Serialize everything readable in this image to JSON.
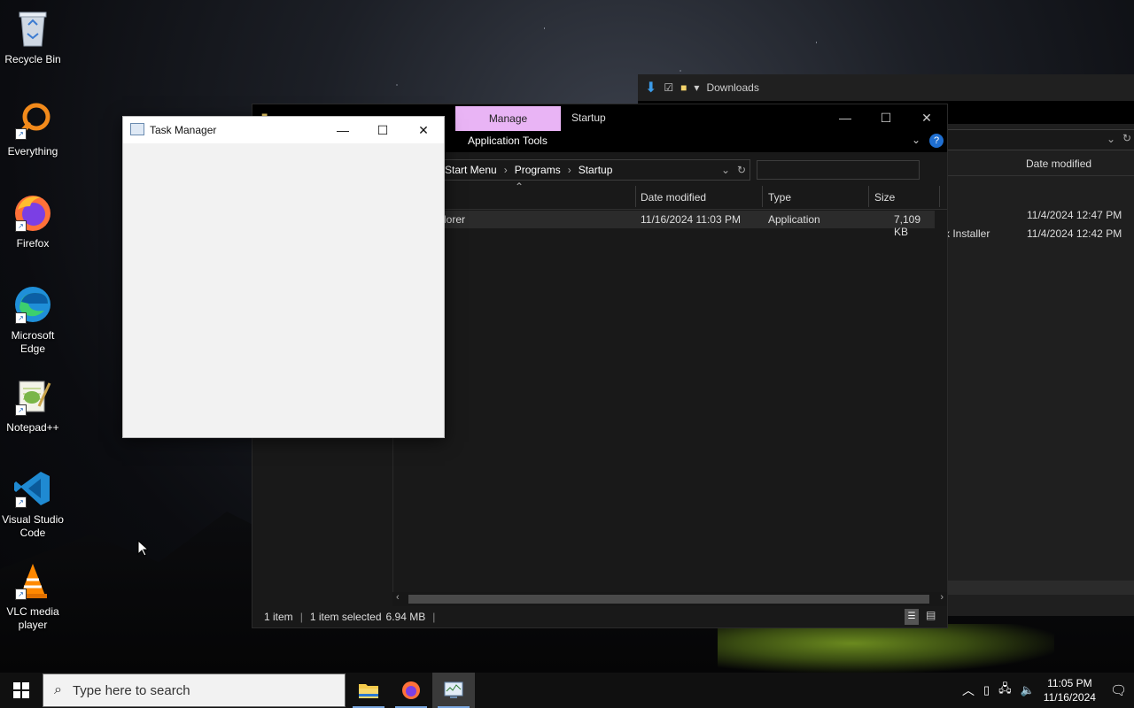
{
  "desktop": {
    "icons": [
      {
        "label_line1": "Recycle Bin",
        "label_line2": "",
        "icon": "recycle-bin-icon"
      },
      {
        "label_line1": "Everything",
        "label_line2": "",
        "icon": "everything-search-icon"
      },
      {
        "label_line1": "Firefox",
        "label_line2": "",
        "icon": "firefox-icon"
      },
      {
        "label_line1": "Microsoft",
        "label_line2": "Edge",
        "icon": "edge-icon"
      },
      {
        "label_line1": "Notepad++",
        "label_line2": "",
        "icon": "notepadpp-icon"
      },
      {
        "label_line1": "Visual Studio",
        "label_line2": "Code",
        "icon": "vscode-icon"
      },
      {
        "label_line1": "VLC media",
        "label_line2": "player",
        "icon": "vlc-icon"
      }
    ]
  },
  "explorer_back": {
    "title": "Downloads",
    "col_date": "Date modified",
    "rows": [
      {
        "name": "",
        "date": "11/4/2024 12:47 PM"
      },
      {
        "name": "x Installer",
        "date": "11/4/2024 12:42 PM"
      }
    ]
  },
  "explorer": {
    "context_tab": "Manage",
    "title": "Startup",
    "ribbon_tab": "Application Tools",
    "breadcrumb": [
      "Start Menu",
      "Programs",
      "Startup"
    ],
    "columns": {
      "date": "Date modified",
      "type": "Type",
      "size": "Size"
    },
    "file": {
      "name": "lorer",
      "date": "11/16/2024 11:03 PM",
      "type": "Application",
      "size": "7,109 KB"
    },
    "status": {
      "count": "1 item",
      "selected": "1 item selected",
      "size": "6.94 MB"
    },
    "colors": {
      "context_tab": "#e9b4f5",
      "help": "#1f6fd1"
    }
  },
  "taskmanager": {
    "title": "Task Manager"
  },
  "taskbar": {
    "search_placeholder": "Type here to search",
    "time": "11:05 PM",
    "date": "11/16/2024"
  }
}
